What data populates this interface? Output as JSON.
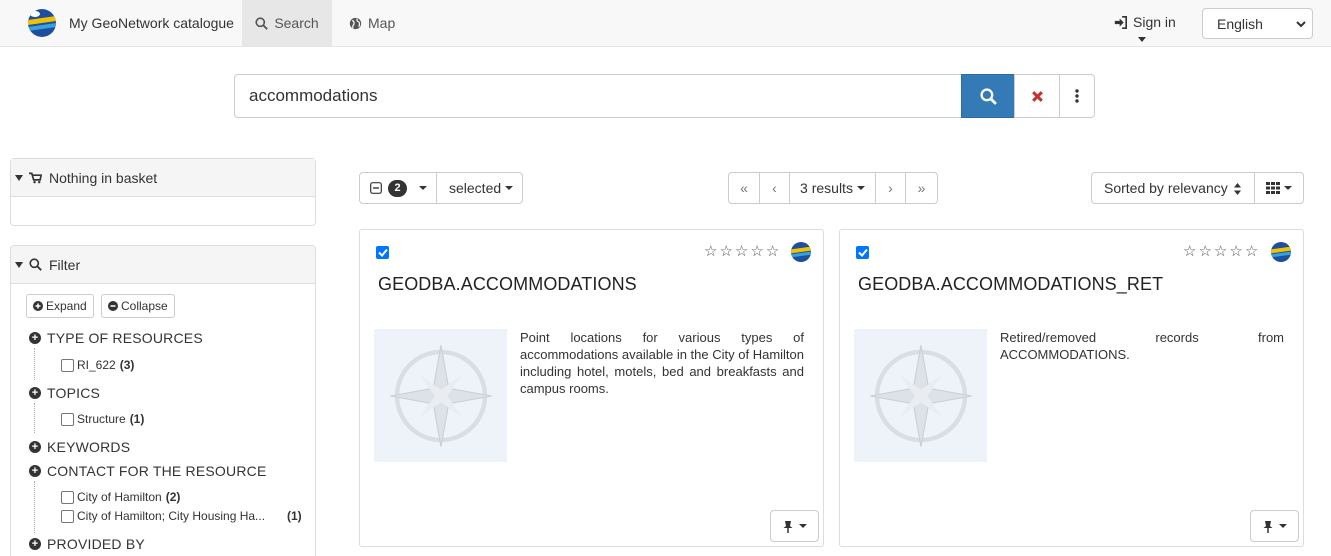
{
  "navbar": {
    "brand": "My GeoNetwork catalogue",
    "tabs": [
      {
        "label": "Search",
        "icon": "search-icon",
        "active": true
      },
      {
        "label": "Map",
        "icon": "globe-icon",
        "active": false
      }
    ],
    "signin_label": "Sign in",
    "language": "English"
  },
  "search": {
    "query": "accommodations"
  },
  "basket": {
    "label": "Nothing in basket"
  },
  "filter": {
    "title": "Filter",
    "expand_label": "Expand",
    "collapse_label": "Collapse",
    "facets": [
      {
        "title": "TYPE OF RESOURCES",
        "items": [
          {
            "label": "RI_622",
            "count": "(3)"
          }
        ]
      },
      {
        "title": "TOPICS",
        "items": [
          {
            "label": "Structure",
            "count": "(1)"
          }
        ]
      },
      {
        "title": "KEYWORDS",
        "items": []
      },
      {
        "title": "CONTACT FOR THE RESOURCE",
        "items": [
          {
            "label": "City of Hamilton",
            "count": "(2)"
          },
          {
            "label": "City of Hamilton; City Housing Ha...",
            "count": "(1)"
          }
        ]
      },
      {
        "title": "PROVIDED BY",
        "items": []
      }
    ]
  },
  "toolbar": {
    "selected_count": "2",
    "selected_label": "selected",
    "pager": {
      "first": "«",
      "prev": "‹",
      "results": "3 results",
      "next": "›",
      "last": "»"
    },
    "sort_label": "Sorted by relevancy"
  },
  "results": [
    {
      "title": "GEODBA.ACCOMMODATIONS",
      "abstract": "Point locations for various types of accommodations available in the City of Hamilton including hotel, motels, bed and breakfasts and campus rooms.",
      "checked": true,
      "rating": 0
    },
    {
      "title": "GEODBA.ACCOMMODATIONS_RET",
      "abstract": "Retired/removed records from ACCOMMODATIONS.",
      "checked": true,
      "rating": 0
    }
  ],
  "colors": {
    "primary": "#337ab7",
    "danger": "#c9302c",
    "navbar_bg": "#f8f8f8"
  }
}
